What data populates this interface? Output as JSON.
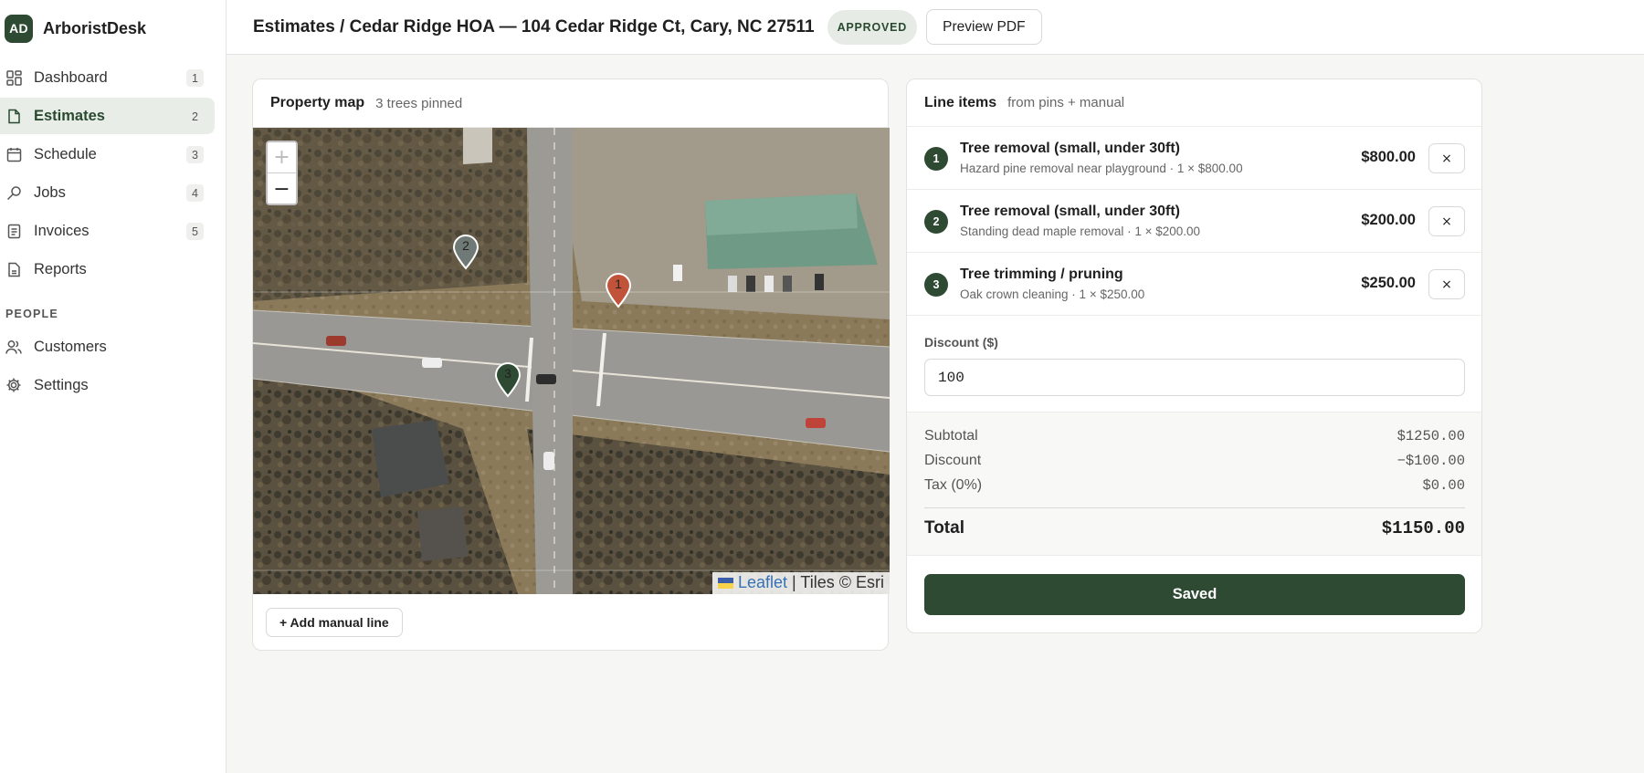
{
  "brand": {
    "initials": "AD",
    "name": "ArboristDesk"
  },
  "sidebar": {
    "items": [
      {
        "label": "Dashboard",
        "badge": "1",
        "icon": "grid-icon"
      },
      {
        "label": "Estimates",
        "badge": "2",
        "icon": "document-icon"
      },
      {
        "label": "Schedule",
        "badge": "3",
        "icon": "calendar-icon"
      },
      {
        "label": "Jobs",
        "badge": "4",
        "icon": "wrench-icon"
      },
      {
        "label": "Invoices",
        "badge": "5",
        "icon": "receipt-icon"
      },
      {
        "label": "Reports",
        "icon": "report-icon"
      }
    ],
    "section_people": "PEOPLE",
    "people_items": [
      {
        "label": "Customers",
        "icon": "users-icon"
      },
      {
        "label": "Settings",
        "icon": "gear-icon"
      }
    ]
  },
  "header": {
    "title": "Estimates / Cedar Ridge HOA — 104 Cedar Ridge Ct, Cary, NC 27511",
    "status": "APPROVED",
    "preview_label": "Preview PDF"
  },
  "map_card": {
    "title": "Property map",
    "subtitle": "3 trees pinned",
    "zoom_in": "+",
    "zoom_out": "−",
    "attribution_link": "Leaflet",
    "attribution_rest": "| Tiles © Esri",
    "markers": [
      {
        "num": "2",
        "color": "#6f7a76"
      },
      {
        "num": "1",
        "color": "#c0533a"
      },
      {
        "num": "3",
        "color": "#2f4a33"
      }
    ],
    "add_manual_label": "+ Add manual line"
  },
  "items_card": {
    "title": "Line items",
    "subtitle": "from pins + manual",
    "remove_label": "×",
    "items": [
      {
        "num": "1",
        "title": "Tree removal (small, under 30ft)",
        "desc": "Hazard pine removal near playground · 1 × $800.00",
        "amount": "$800.00"
      },
      {
        "num": "2",
        "title": "Tree removal (small, under 30ft)",
        "desc": "Standing dead maple removal · 1 × $200.00",
        "amount": "$200.00"
      },
      {
        "num": "3",
        "title": "Tree trimming / pruning",
        "desc": "Oak crown cleaning · 1 × $250.00",
        "amount": "$250.00"
      }
    ],
    "discount_label": "Discount ($)",
    "discount_value": "100",
    "totals": {
      "subtotal_label": "Subtotal",
      "subtotal": "$1250.00",
      "discount_label": "Discount",
      "discount": "−$100.00",
      "tax_label": "Tax (0%)",
      "tax": "$0.00",
      "total_label": "Total",
      "total": "$1150.00"
    },
    "saved_label": "Saved"
  },
  "colors": {
    "accent": "#2f4a33",
    "marker_1": "#c0533a",
    "marker_2": "#6f7a76",
    "marker_3": "#2f4a33"
  }
}
